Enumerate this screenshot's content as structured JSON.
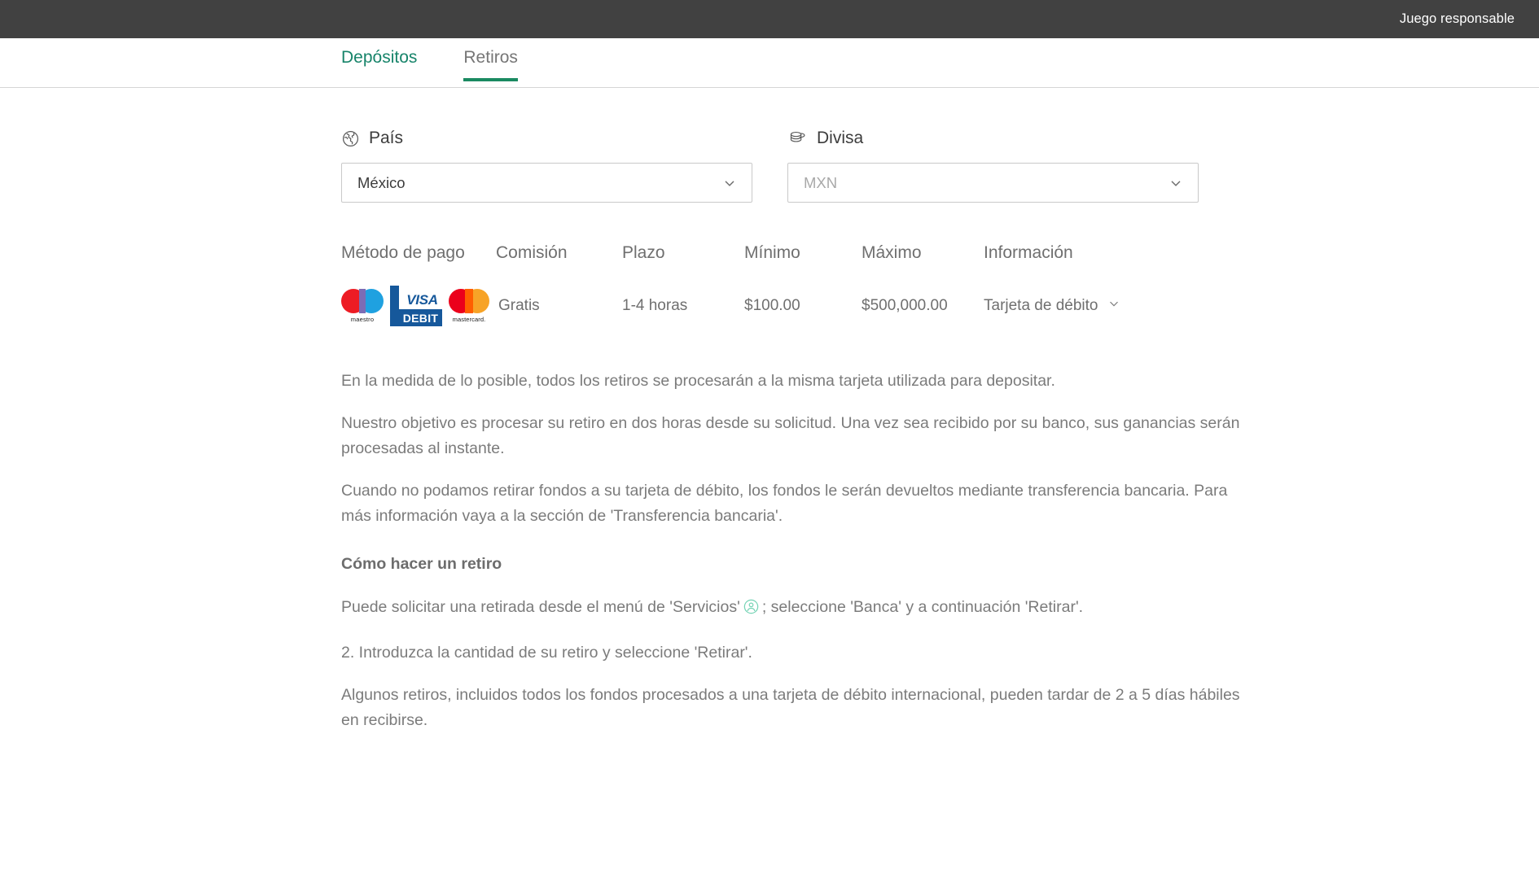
{
  "topbar": {
    "link_label": "Juego responsable"
  },
  "tabs": [
    {
      "label": "Depósitos",
      "active": false,
      "accent": true
    },
    {
      "label": "Retiros",
      "active": true,
      "accent": false
    }
  ],
  "selectors": {
    "country": {
      "label": "País",
      "icon": "globe-icon",
      "value": "México",
      "chevron": "chevron-down-icon"
    },
    "currency": {
      "label": "Divisa",
      "icon": "coins-icon",
      "value": "MXN",
      "is_placeholder": true,
      "chevron": "chevron-down-icon"
    }
  },
  "payments_table": {
    "headers": [
      "Método de pago",
      "Comisión",
      "Plazo",
      "Mínimo",
      "Máximo",
      "Información"
    ],
    "rows": [
      {
        "methods": [
          {
            "name": "maestro-logo",
            "label": "maestro"
          },
          {
            "name": "visa-debit-logo",
            "line1": "VISA",
            "line2": "DEBIT"
          },
          {
            "name": "mastercard-logo",
            "label": "mastercard."
          }
        ],
        "fee": "Gratis",
        "time": "1-4 horas",
        "min": "$100.00",
        "max": "$500,000.00",
        "info": "Tarjeta de débito",
        "info_chevron": "chevron-down-icon"
      }
    ]
  },
  "copy": {
    "p1": "En la medida de lo posible, todos los retiros se procesarán a la misma tarjeta utilizada para depositar.",
    "p2": "Nuestro objetivo es procesar su retiro en dos horas desde su solicitud. Una vez sea recibido por su banco, sus ganancias serán procesadas al instante.",
    "p3": "Cuando no podamos retirar fondos a su tarjeta de débito, los fondos le serán devueltos mediante transferencia bancaria. Para más información vaya a la sección de 'Transferencia bancaria'.",
    "heading": "Cómo hacer un retiro",
    "p4_before": "Puede solicitar una retirada desde el menú de 'Servicios'",
    "p4_icon": "account-person-icon",
    "p4_after": "; seleccione 'Banca' y a continuación 'Retirar'.",
    "p5": "2. Introduzca la cantidad de su retiro y seleccione 'Retirar'.",
    "p6": "Algunos retiros, incluidos todos los fondos procesados a una tarjeta de débito internacional, pueden tardar de 2 a 5 días hábiles en recibirse."
  },
  "colors": {
    "topbar_bg": "#414141",
    "tab_accent": "#17846a",
    "tab_underline": "#1a8a61",
    "body_text": "#7b7b7b",
    "inline_icon": "#74d3b4"
  }
}
